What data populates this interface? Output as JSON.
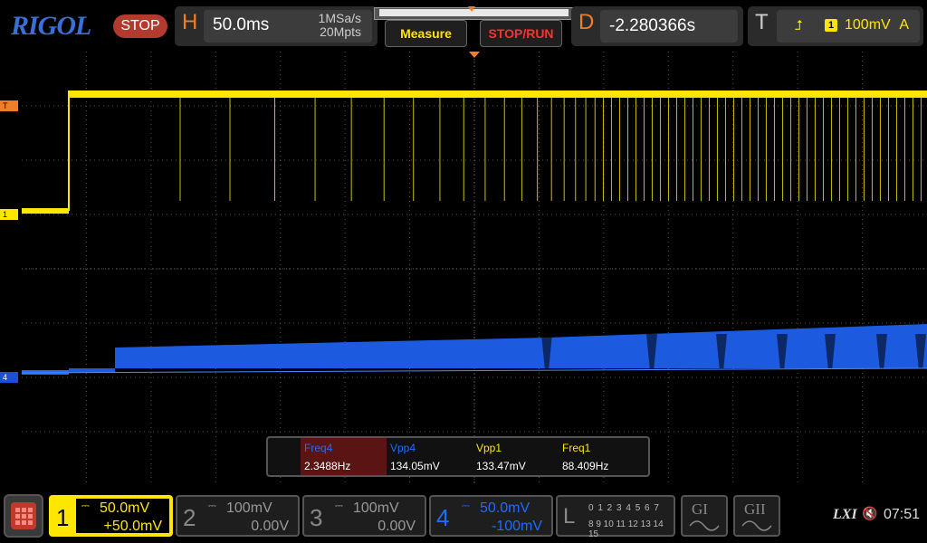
{
  "brand": {
    "logo": "RIGOL",
    "run_state": "STOP"
  },
  "horizontal": {
    "label": "H",
    "timebase": "50.0ms",
    "sample_rate": "1MSa/s",
    "memory_depth": "20Mpts"
  },
  "buttons": {
    "measure": "Measure",
    "stop_run": "STOP/RUN"
  },
  "delay": {
    "label": "D",
    "value": "-2.280366s"
  },
  "trigger": {
    "label": "T",
    "edge_icon": "rising-edge-icon",
    "channel": "1",
    "level": "100mV",
    "mode": "A"
  },
  "markers": {
    "trigger_level": "T",
    "ch1": "1",
    "ch4": "4",
    "trigger_pos": "T"
  },
  "measurements": [
    {
      "name": "Freq4",
      "value": "2.3488Hz",
      "color": "#1f6cff",
      "highlight": true
    },
    {
      "name": "Vpp4",
      "value": "134.05mV",
      "color": "#1f6cff",
      "highlight": false
    },
    {
      "name": "Vpp1",
      "value": "133.47mV",
      "color": "#ffe600",
      "highlight": false
    },
    {
      "name": "Freq1",
      "value": "88.409Hz",
      "color": "#ffe600",
      "highlight": false
    }
  ],
  "channels": [
    {
      "num": "1",
      "coupling": "⎓",
      "scale": "50.0mV",
      "offset": "+50.0mV",
      "active": true
    },
    {
      "num": "2",
      "coupling": "⎓",
      "scale": "100mV",
      "offset": "0.00V",
      "active": false
    },
    {
      "num": "3",
      "coupling": "⎓",
      "scale": "100mV",
      "offset": "0.00V",
      "active": false
    },
    {
      "num": "4",
      "coupling": "⎓",
      "scale": "50.0mV",
      "offset": "-100mV",
      "active": true
    }
  ],
  "logic": {
    "label": "L",
    "row1": "0 1 2 3   4 5 6 7",
    "row2": "8 9 10 11 12 13 14 15"
  },
  "generators": [
    {
      "label": "GI"
    },
    {
      "label": "GII"
    }
  ],
  "status": {
    "lxi": "LXI",
    "speaker_icon": "speaker-muted-icon",
    "time": "07:51"
  },
  "colors": {
    "ch1": "#ffe600",
    "ch4": "#1f6cff",
    "accent": "#f07e26",
    "grid": "#555555"
  }
}
